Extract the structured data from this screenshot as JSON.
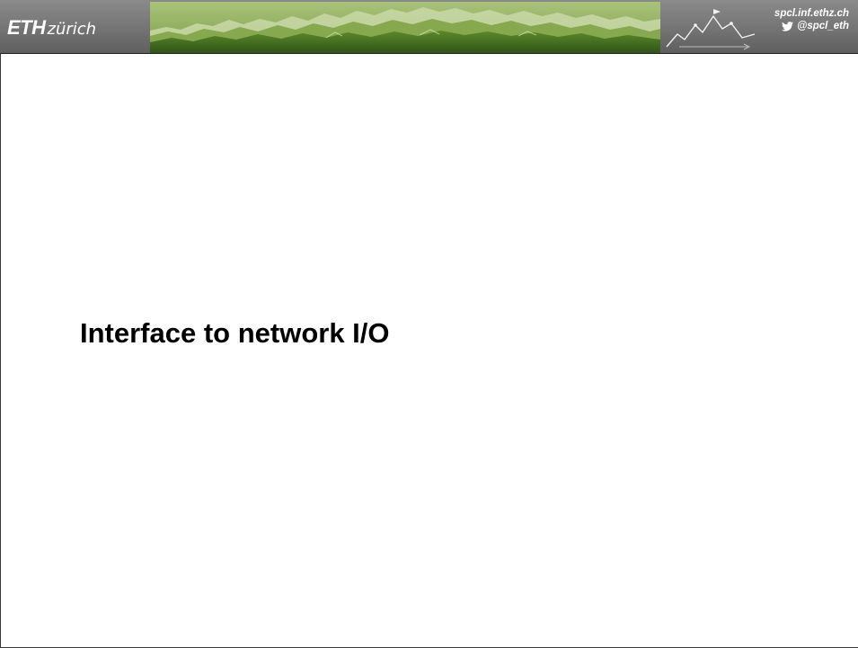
{
  "header": {
    "logo": {
      "bold": "ETH",
      "light": "zürich"
    },
    "contact": {
      "website": "spcl.inf.ethz.ch",
      "twitter_handle": "@spcl_eth",
      "twitter_icon": "twitter-bird-icon"
    },
    "banner_icon": "mountain-panorama-image",
    "spcl_icon": "spcl-mountain-logo"
  },
  "slide": {
    "title": "Interface to network I/O"
  },
  "colors": {
    "header_dark": "#5f5f5f",
    "header_light": "#8a8a8a",
    "banner_green": "#5e8a2c",
    "title_text": "#000000",
    "background": "#ffffff"
  }
}
